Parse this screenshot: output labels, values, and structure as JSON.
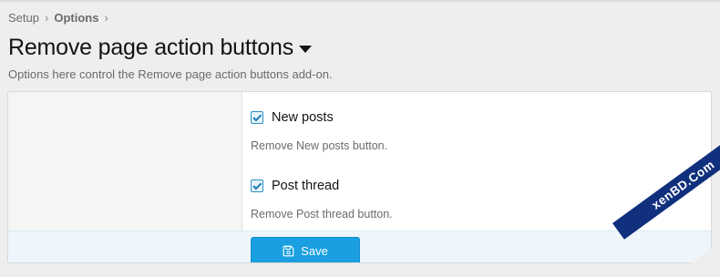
{
  "breadcrumb": {
    "items": [
      "Setup",
      "Options"
    ],
    "separator": "›"
  },
  "header": {
    "title": "Remove page action buttons",
    "description": "Options here control the Remove page action buttons add-on."
  },
  "options": [
    {
      "label": "New posts",
      "hint": "Remove New posts button.",
      "checked": true
    },
    {
      "label": "Post thread",
      "hint": "Remove Post thread button.",
      "checked": true
    }
  ],
  "form": {
    "save_label": "Save"
  },
  "watermark": {
    "text": "xenBD.Com"
  },
  "colors": {
    "accent": "#1aa0e2",
    "checkbox": "#2d8fc4",
    "watermark_bg": "#10307e"
  }
}
